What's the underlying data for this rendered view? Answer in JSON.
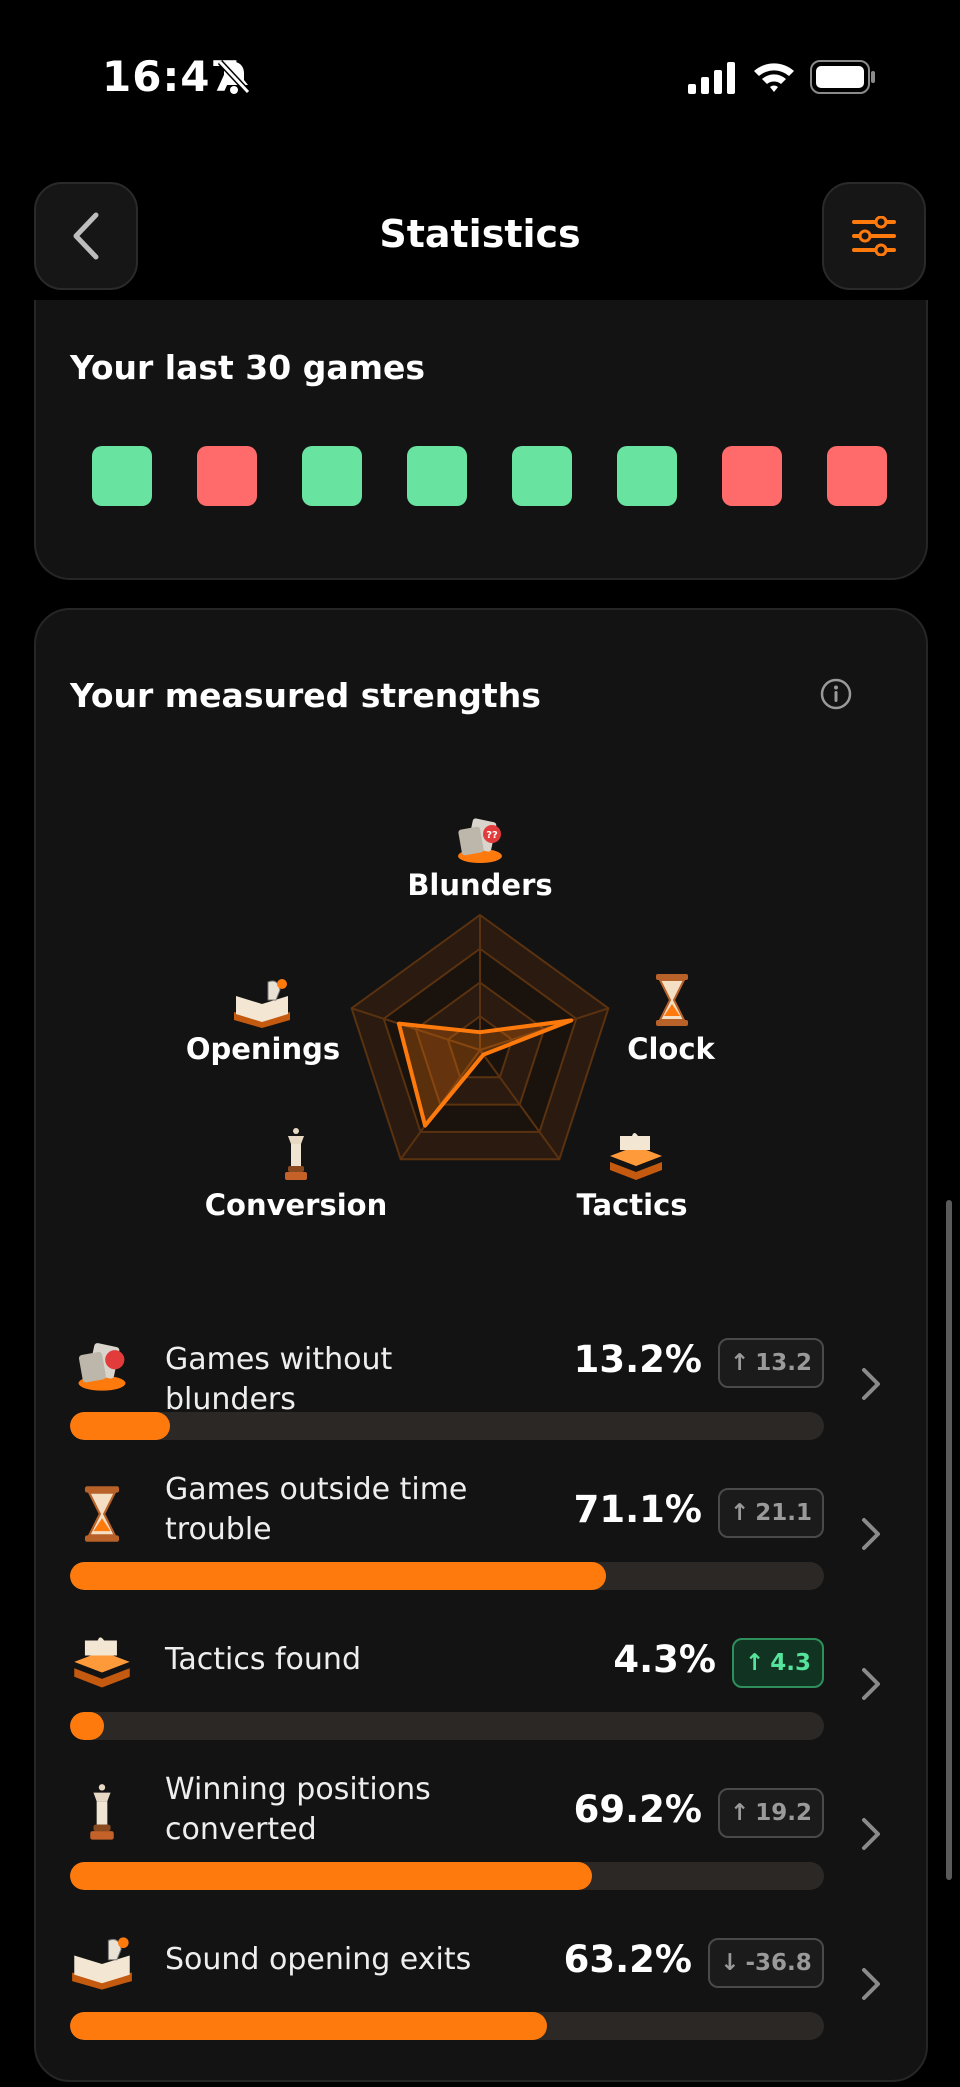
{
  "status": {
    "time": "16:47"
  },
  "header": {
    "title": "Statistics"
  },
  "last_games": {
    "title": "Your last 30 games",
    "results": [
      "win",
      "loss",
      "win",
      "win",
      "win",
      "win",
      "loss",
      "loss"
    ],
    "colors": {
      "win": "#69e3a0",
      "loss": "#ff6b6b"
    }
  },
  "strengths": {
    "title": "Your measured strengths",
    "axes": [
      "Blunders",
      "Clock",
      "Tactics",
      "Conversion",
      "Openings"
    ],
    "metrics": [
      {
        "label": "Games without blunders",
        "value": "13.2%",
        "fraction": 0.132,
        "delta": "13.2",
        "direction": "up",
        "badge_style": "neutral",
        "icon": "blunder-icon"
      },
      {
        "label": "Games outside time trouble",
        "value": "71.1%",
        "fraction": 0.711,
        "delta": "21.1",
        "direction": "up",
        "badge_style": "neutral",
        "icon": "hourglass-icon"
      },
      {
        "label": "Tactics found",
        "value": "4.3%",
        "fraction": 0.043,
        "delta": "4.3",
        "direction": "up",
        "badge_style": "green",
        "icon": "puzzle-icon"
      },
      {
        "label": "Winning positions converted",
        "value": "69.2%",
        "fraction": 0.692,
        "delta": "19.2",
        "direction": "up",
        "badge_style": "neutral",
        "icon": "queen-icon"
      },
      {
        "label": "Sound opening exits",
        "value": "63.2%",
        "fraction": 0.632,
        "delta": "-36.8",
        "direction": "down",
        "badge_style": "neutral",
        "icon": "opening-book-icon"
      }
    ]
  },
  "colors": {
    "accent": "#ff7a0d",
    "background": "#000000",
    "card": "#131313"
  }
}
